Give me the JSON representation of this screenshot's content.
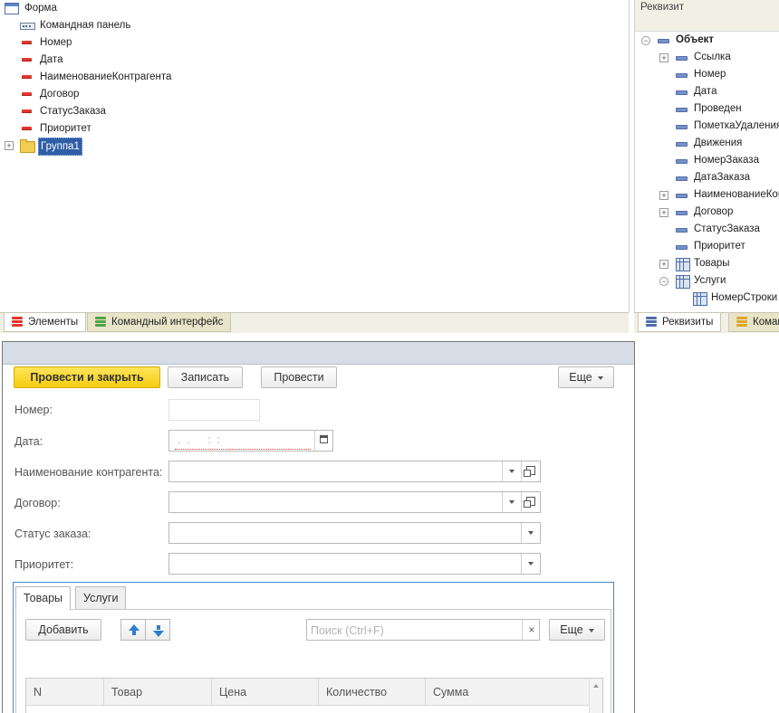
{
  "elements_tree": {
    "root": "Форма",
    "items": [
      "Командная панель",
      "Номер",
      "Дата",
      "НаименованиеКонтрагента",
      "Договор",
      "СтатусЗаказа",
      "Приоритет"
    ],
    "group": "Группа1"
  },
  "left_tabs": {
    "elements": "Элементы",
    "command_interface": "Командный интерфейс"
  },
  "attributes_panel": {
    "header": "Реквизит",
    "root": "Объект",
    "items": [
      "Ссылка",
      "Номер",
      "Дата",
      "Проведен",
      "ПометкаУдаления",
      "Движения",
      "НомерЗаказа",
      "ДатаЗаказа",
      "НаименованиеКон",
      "Договор",
      "СтатусЗаказа",
      "Приоритет",
      "Товары",
      "Услуги"
    ],
    "child": "НомерСтроки"
  },
  "right_tabs": {
    "attributes": "Реквизиты",
    "commands": "Коман"
  },
  "form_preview": {
    "toolbar": {
      "post_close": "Провести и закрыть",
      "save": "Записать",
      "post": "Провести",
      "more": "Еще"
    },
    "fields": {
      "number_label": "Номер:",
      "date_label": "Дата:",
      "date_mask": " .  .      :  :",
      "counterparty_label": "Наименование контрагента:",
      "contract_label": "Договор:",
      "status_label": "Статус заказа:",
      "priority_label": "Приоритет:"
    },
    "tabs": [
      "Товары",
      "Услуги"
    ],
    "table_toolbar": {
      "add": "Добавить",
      "search_placeholder": "Поиск (Ctrl+F)",
      "clear": "×",
      "more": "Еще"
    },
    "columns": [
      "N",
      "Товар",
      "Цена",
      "Количество",
      "Сумма"
    ]
  },
  "colors": {
    "primary_button": "#f5cc0f",
    "selection": "#2f5ea8",
    "page_border": "#3e8ad6",
    "attribute_icon": "#7793c4",
    "element_icon": "#e0382e"
  }
}
